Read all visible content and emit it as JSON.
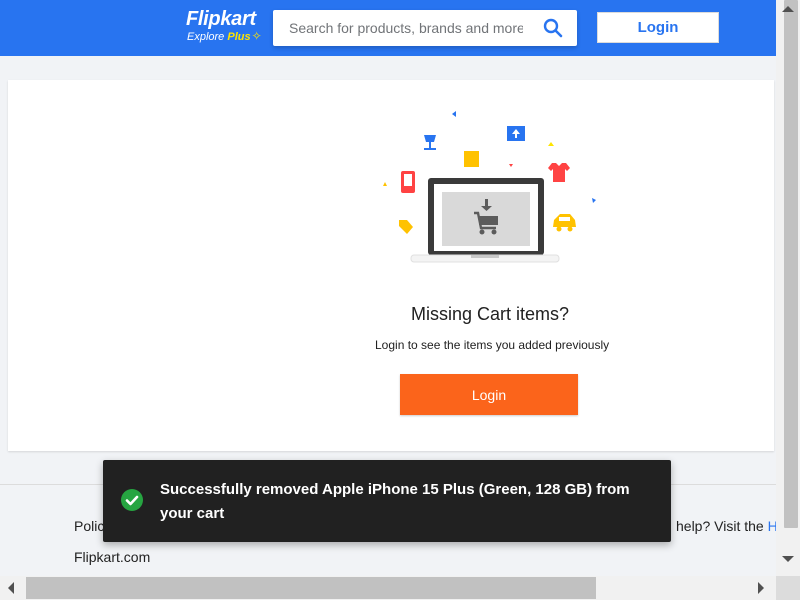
{
  "header": {
    "logo_name": "Flipkart",
    "logo_explore": "Explore",
    "logo_plus": "Plus",
    "search_placeholder": "Search for products, brands and more",
    "login_label": "Login",
    "brand_color": "#2874f0",
    "plus_color": "#ffe500"
  },
  "cart": {
    "title": "Missing Cart items?",
    "subtitle": "Login to see the items you added previously",
    "login_label": "Login",
    "button_color": "#fb641b"
  },
  "footer": {
    "left_text": "Polic",
    "right_text": "help? Visit the ",
    "right_link": "H",
    "site": "Flipkart.com"
  },
  "toast": {
    "message": "Successfully removed Apple iPhone 15 Plus (Green, 128 GB) from your cart",
    "icon": "check-circle-icon",
    "icon_color": "#26a541"
  }
}
